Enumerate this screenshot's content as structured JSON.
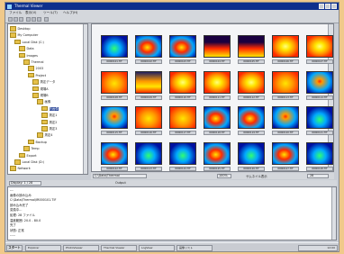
{
  "window": {
    "title": "Thermal Viewer"
  },
  "menu": [
    "ファイル",
    "表示(V)",
    "ツール(T)",
    "ヘルプ(H)"
  ],
  "tree": {
    "items": [
      {
        "label": "Desktop",
        "level": 0
      },
      {
        "label": "My Computer",
        "level": 0
      },
      {
        "label": "Local Disk (C:)",
        "level": 1
      },
      {
        "label": "Data",
        "level": 2
      },
      {
        "label": "Images",
        "level": 2
      },
      {
        "label": "Thermal",
        "level": 3
      },
      {
        "label": "2003",
        "level": 4
      },
      {
        "label": "Project",
        "level": 4
      },
      {
        "label": "測定データ",
        "level": 5
      },
      {
        "label": "現場A",
        "level": 5
      },
      {
        "label": "現場B",
        "level": 5
      },
      {
        "label": "画像",
        "level": 6
      },
      {
        "label": "熱画像",
        "level": 7
      },
      {
        "label": "測定1",
        "level": 7
      },
      {
        "label": "測定2",
        "level": 7
      },
      {
        "label": "測定3",
        "level": 7
      },
      {
        "label": "測定4",
        "level": 6
      },
      {
        "label": "Backup",
        "level": 4
      },
      {
        "label": "Temp",
        "level": 3
      },
      {
        "label": "Export",
        "level": 2
      },
      {
        "label": "Local Disk (D:)",
        "level": 1
      },
      {
        "label": "Network",
        "level": 0
      }
    ],
    "selected_index": 12
  },
  "thumbnails": [
    {
      "caption": "IR000101.TIF",
      "theme": "blue"
    },
    {
      "caption": "IR000102.TIF",
      "theme": "mixed"
    },
    {
      "caption": "IR000103.TIF",
      "theme": "mixed"
    },
    {
      "caption": "IR000104.TIF",
      "theme": "hotdark"
    },
    {
      "caption": "IR000105.TIF",
      "theme": "hotdark"
    },
    {
      "caption": "IR000106.TIF",
      "theme": "hot"
    },
    {
      "caption": "IR000107.TIF",
      "theme": "hot"
    },
    {
      "caption": "IR000108.TIF",
      "theme": "warm"
    },
    {
      "caption": "IR000109.TIF",
      "theme": "warmdark"
    },
    {
      "caption": "IR000110.TIF",
      "theme": "hot"
    },
    {
      "caption": "IR000111.TIF",
      "theme": "hot"
    },
    {
      "caption": "IR000112.TIF",
      "theme": "hot"
    },
    {
      "caption": "IR000113.TIF",
      "theme": "warm"
    },
    {
      "caption": "IR000114.TIF",
      "theme": "cool"
    },
    {
      "caption": "IR000115.TIF",
      "theme": "cool"
    },
    {
      "caption": "IR000116.TIF",
      "theme": "warm"
    },
    {
      "caption": "IR000117.TIF",
      "theme": "warm"
    },
    {
      "caption": "IR000118.TIF",
      "theme": "mixed"
    },
    {
      "caption": "IR000119.TIF",
      "theme": "mixed"
    },
    {
      "caption": "IR000120.TIF",
      "theme": "cool"
    },
    {
      "caption": "IR000121.TIF",
      "theme": "blue"
    },
    {
      "caption": "IR000122.TIF",
      "theme": "mixed"
    },
    {
      "caption": "IR000123.TIF",
      "theme": "blue"
    },
    {
      "caption": "IR000124.TIF",
      "theme": "blue"
    },
    {
      "caption": "IR000125.TIF",
      "theme": "mixed"
    },
    {
      "caption": "IR000126.TIF",
      "theme": "blue"
    },
    {
      "caption": "IR000127.TIF",
      "theme": "mixed"
    },
    {
      "caption": "IR000128.TIF",
      "theme": "blue"
    }
  ],
  "status": {
    "path": "C:\\Data\\Thermal",
    "zoom": "100%",
    "search_label": "サムネイル表示",
    "count": "28"
  },
  "tabs": {
    "label": "Display: 1 / 28",
    "right": "Output"
  },
  "log": {
    "lines": [
      "---",
      "画像の読み込み",
      "C:\\Data\\Thermal\\IR000101.TIF",
      "読み込み完了",
      "変換中...",
      "処理: 28 ファイル",
      "温度範囲: 20.0 - 80.0",
      "完了",
      "状態: 正常",
      "-----"
    ]
  },
  "taskbar": {
    "start": "スタート",
    "tasks": [
      "Explorer",
      "PhotoViewer",
      "Thermal Viewer",
      "LogView",
      "画像リスト"
    ],
    "clock": "12:00"
  },
  "colors": {
    "titlebar": "#0e2f8c",
    "palette_hot": [
      "#ff2a00",
      "#ff9a00",
      "#ffe600"
    ],
    "palette_cool": [
      "#0010a0",
      "#00a8ff",
      "#30ff70"
    ]
  }
}
